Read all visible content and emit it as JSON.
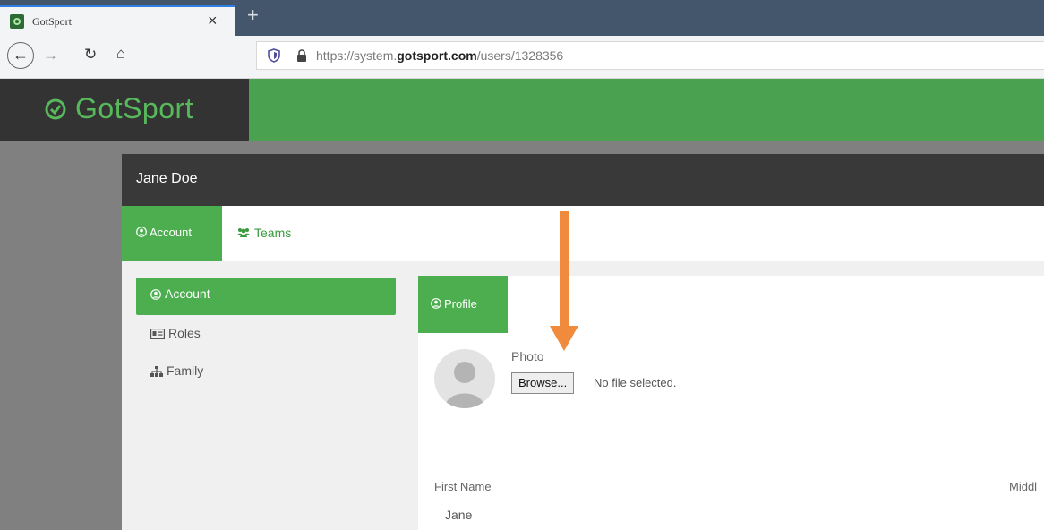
{
  "browser": {
    "tab_title": "GotSport",
    "tab_close": "×",
    "new_tab": "+",
    "url_prefix": "https://system.",
    "url_domain": "gotsport.com",
    "url_path": "/users/1328356",
    "icons": {
      "back": "back-arrow-icon",
      "forward": "forward-arrow-icon",
      "reload": "reload-icon",
      "home": "home-icon",
      "shield": "shield-icon",
      "lock": "lock-icon"
    }
  },
  "site": {
    "logo_text": "GotSport",
    "brand_color": "#4aa14f"
  },
  "modal": {
    "title": "Jane Doe",
    "top_tabs": [
      {
        "label": "Account",
        "icon": "user-circle-icon",
        "active": true
      },
      {
        "label": "Teams",
        "icon": "users-icon",
        "active": false
      }
    ],
    "side_nav": [
      {
        "label": "Account",
        "icon": "user-circle-icon",
        "active": true
      },
      {
        "label": "Roles",
        "icon": "id-card-icon",
        "active": false
      },
      {
        "label": "Family",
        "icon": "sitemap-icon",
        "active": false
      }
    ],
    "panel": {
      "tab_label": "Profile",
      "photo_label": "Photo",
      "browse_label": "Browse...",
      "no_file_text": "No file selected.",
      "first_name_label": "First Name",
      "middle_label": "Middl",
      "first_name_value": "Jane"
    }
  },
  "annotation": {
    "arrow_color": "#f08a3c"
  }
}
